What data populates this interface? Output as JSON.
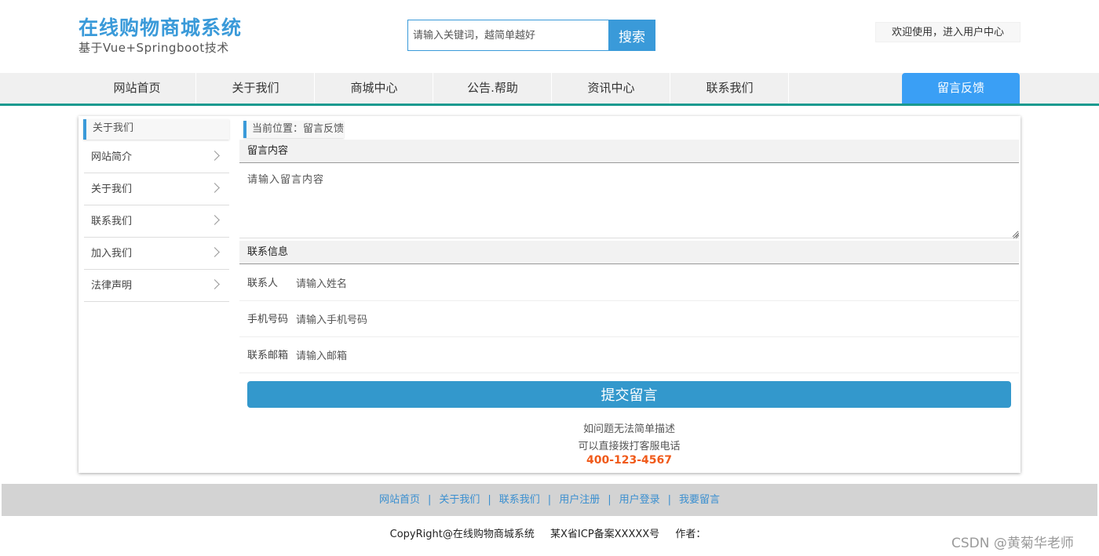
{
  "header": {
    "title": "在线购物商城系统",
    "subtitle": "基于Vue+Springboot技术",
    "search_placeholder": "请输入关键词，越简单越好",
    "search_button": "搜索",
    "user_center": "欢迎使用，进入用户中心"
  },
  "nav": {
    "items": [
      {
        "label": "网站首页"
      },
      {
        "label": "关于我们"
      },
      {
        "label": "商城中心"
      },
      {
        "label": "公告.帮助"
      },
      {
        "label": "资讯中心"
      },
      {
        "label": "联系我们"
      },
      {
        "label": "留言反馈"
      }
    ],
    "active": "留言反馈",
    "active_color": "#3a9ff5",
    "underline_color": "#1a9a8f"
  },
  "sidebar": {
    "title": "关于我们",
    "items": [
      {
        "label": "网站简介"
      },
      {
        "label": "关于我们"
      },
      {
        "label": "联系我们"
      },
      {
        "label": "加入我们"
      },
      {
        "label": "法律声明"
      }
    ]
  },
  "main": {
    "breadcrumb": "当前位置：留言反馈",
    "message_section": "留言内容",
    "message_placeholder": "请输入留言内容",
    "contact_section": "联系信息",
    "fields": [
      {
        "label": "联系人",
        "placeholder": "请输入姓名",
        "value": ""
      },
      {
        "label": "手机号码",
        "placeholder": "请输入手机号码",
        "value": ""
      },
      {
        "label": "联系邮箱",
        "placeholder": "请输入邮箱",
        "value": ""
      }
    ],
    "submit": "提交留言",
    "help_line1": "如问题无法简单描述",
    "help_line2": "可以直接拨打客服电话",
    "phone": "400-123-4567"
  },
  "footer": {
    "links": [
      {
        "label": "网站首页"
      },
      {
        "label": "关于我们"
      },
      {
        "label": "联系我们"
      },
      {
        "label": "用户注册"
      },
      {
        "label": "用户登录"
      },
      {
        "label": "我要留言"
      }
    ],
    "separator": "|",
    "copyright": "CopyRight@在线购物商城系统",
    "icp": "某X省ICP备案XXXXX号",
    "author": "作者："
  },
  "watermark": "CSDN @黄菊华老师",
  "colors": {
    "brand": "#3a9ad9",
    "button": "#3398cc",
    "phone": "#f05a1a"
  }
}
